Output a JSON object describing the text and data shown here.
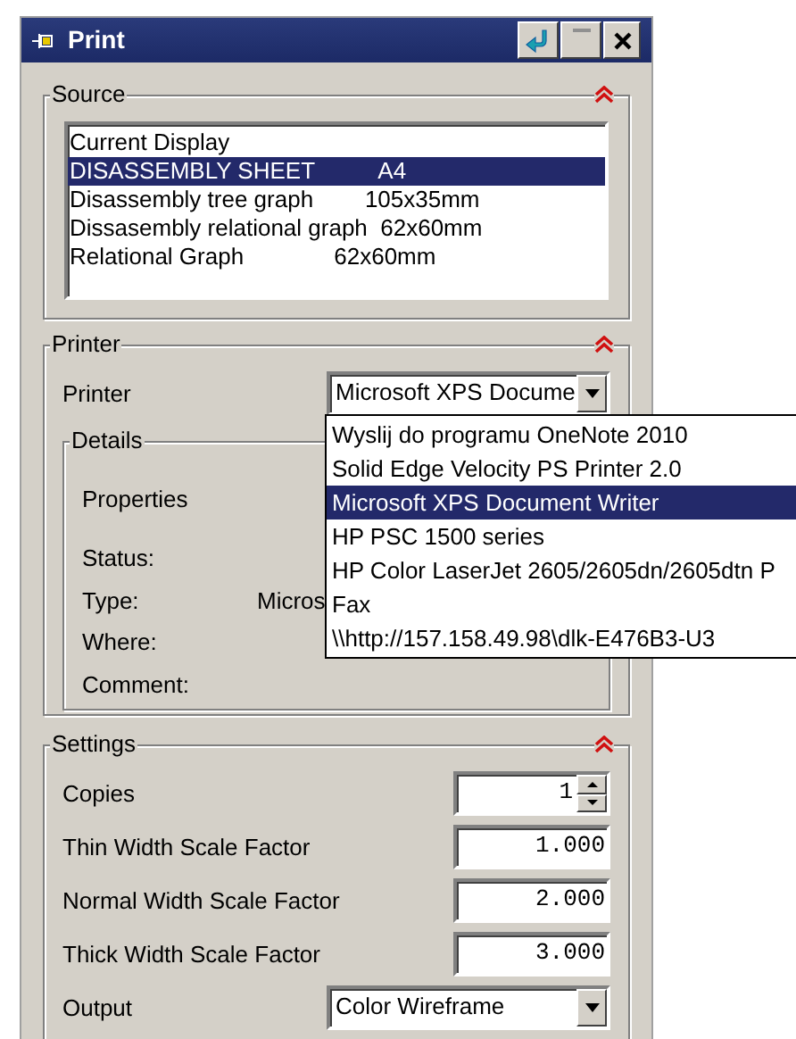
{
  "window": {
    "title": "Print"
  },
  "source": {
    "title": "Source",
    "expanded": true,
    "items": [
      {
        "label": "Current Display",
        "selected": false
      },
      {
        "label": "DISASSEMBLY SHEET          A4",
        "selected": true
      },
      {
        "label": "Disassembly tree graph        105x35mm",
        "selected": false
      },
      {
        "label": "Dissasembly relational graph  62x60mm",
        "selected": false
      },
      {
        "label": "Relational Graph              62x60mm",
        "selected": false
      }
    ]
  },
  "printer": {
    "title": "Printer",
    "expanded": true,
    "printer_label": "Printer",
    "printer_value": "Microsoft XPS Docume",
    "dropdown": {
      "open": true,
      "items": [
        {
          "label": "Wyslij do programu OneNote 2010",
          "selected": false
        },
        {
          "label": "Solid Edge Velocity PS Printer 2.0",
          "selected": false
        },
        {
          "label": "Microsoft XPS Document Writer",
          "selected": true
        },
        {
          "label": "HP PSC 1500 series",
          "selected": false
        },
        {
          "label": "HP Color LaserJet 2605/2605dn/2605dtn P",
          "selected": false
        },
        {
          "label": "Fax",
          "selected": false
        },
        {
          "label": "\\\\http://157.158.49.98\\dlk-E476B3-U3",
          "selected": false
        }
      ]
    },
    "details": {
      "title": "Details",
      "properties_label": "Properties",
      "fields": [
        {
          "label": "Status:"
        },
        {
          "label": "Type:",
          "value": "Micros"
        },
        {
          "label": "Where:"
        },
        {
          "label": "Comment:"
        }
      ]
    }
  },
  "settings": {
    "title": "Settings",
    "expanded": true,
    "fields": [
      {
        "kind": "spin",
        "label": "Copies",
        "value": "1"
      },
      {
        "kind": "number",
        "label": "Thin Width Scale Factor",
        "value": "1.000"
      },
      {
        "kind": "number",
        "label": "Normal Width Scale Factor",
        "value": "2.000"
      },
      {
        "kind": "number",
        "label": "Thick Width Scale Factor",
        "value": "3.000"
      },
      {
        "kind": "select",
        "label": "Output",
        "value": "Color Wireframe"
      }
    ]
  }
}
